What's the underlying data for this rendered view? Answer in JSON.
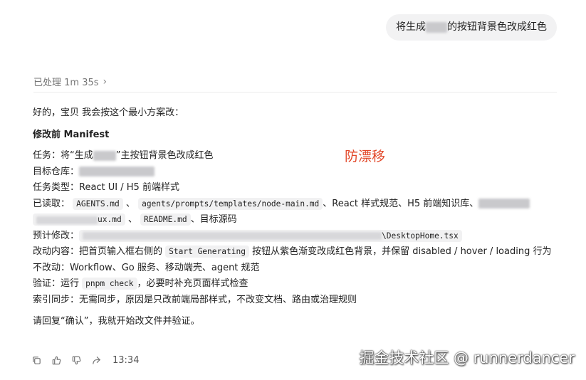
{
  "user_message": {
    "prefix": "将生成",
    "suffix": "的按钮背景色改成红色"
  },
  "thinking": {
    "label": "已处理 1m 35s"
  },
  "response": {
    "intro": "好的，宝贝 我会按这个最小方案改：",
    "heading": "修改前 Manifest",
    "task": {
      "label": "任务：将“生成",
      "suffix": "”主按钮背景色改成红色"
    },
    "repo": {
      "label": "目标仓库："
    },
    "task_type": "任务类型：React UI / H5 前端样式",
    "read": {
      "label": "已读取：",
      "code1": "AGENTS.md",
      "sep1": "、",
      "code2": "agents/prompts/templates/node-main.md",
      "text": "、React 样式规范、H5 前端知识库、",
      "code3_visible": "ux.md",
      "sep2": "、",
      "code4": "README.md",
      "suffix": "、目标源码"
    },
    "expected": {
      "label": "预计修改：",
      "code": "\\DesktopHome.tsx"
    },
    "change": {
      "label": "改动内容：把首页输入框右侧的",
      "code": "Start Generating",
      "suffix": "按钮从紫色渐变改成红色背景，并保留 disabled / hover / loading 行为"
    },
    "unchanged": "不改动：Workflow、Go 服务、移动端壳、agent 规范",
    "verify": {
      "label": "验证：运行",
      "code": "pnpm check",
      "suffix": "，必要时补充页面样式检查"
    },
    "index_sync": "索引同步：无需同步，原因是只改前端局部样式，不改变文档、路由或治理规则",
    "reply": "请回复“确认”，我就开始改文件并验证。"
  },
  "overlay_text": "防漂移",
  "actions": {
    "icons": [
      "copy-icon",
      "thumbs-up-icon",
      "thumbs-down-icon",
      "share-icon"
    ],
    "time": "13:34"
  },
  "watermark": "掘金技术社区 @ runnerdancer"
}
